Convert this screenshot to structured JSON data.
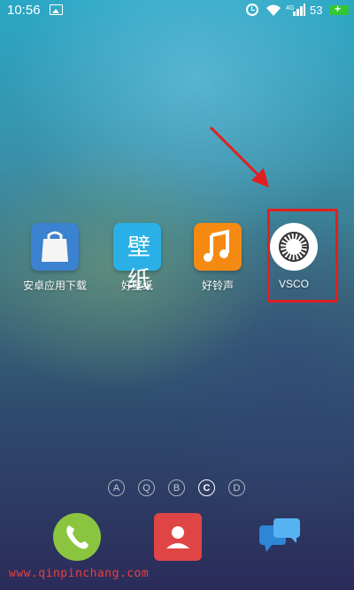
{
  "status_bar": {
    "time": "10:56",
    "signal_label": "4G",
    "battery_level": "53"
  },
  "apps": [
    {
      "label": "安卓应用下载",
      "icon": "shopping-bag-icon",
      "color": "#3b82d0"
    },
    {
      "label": "好壁纸",
      "icon": "wallpaper-icon",
      "glyph": "壁纸",
      "color": "#2ab0e6"
    },
    {
      "label": "好铃声",
      "icon": "music-note-icon",
      "color": "#f58a13"
    },
    {
      "label": "VSCO",
      "icon": "vsco-icon",
      "color": "#ffffff"
    }
  ],
  "page_indicators": [
    "A",
    "Q",
    "B",
    "C",
    "D"
  ],
  "active_page": "C",
  "dock": [
    {
      "name": "phone",
      "icon": "phone-icon",
      "color": "#8bc53f"
    },
    {
      "name": "contacts",
      "icon": "contact-icon",
      "color": "#e04545"
    },
    {
      "name": "messages",
      "icon": "chat-icon",
      "color": "#2e86d6"
    }
  ],
  "watermark": "www.qinpinchang.com",
  "highlight_color": "#e02020"
}
